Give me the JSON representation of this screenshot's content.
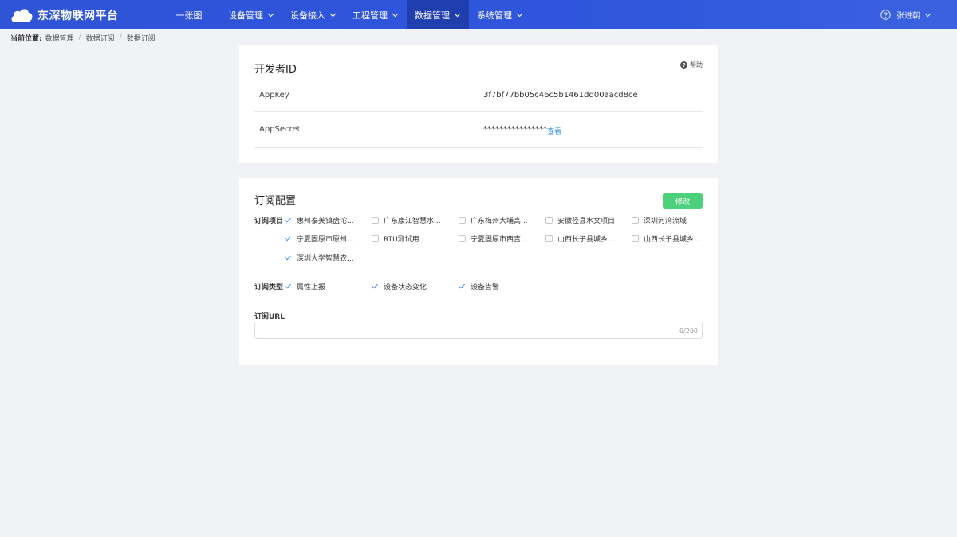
{
  "app": {
    "title": "东深物联网平台"
  },
  "nav": {
    "items": [
      {
        "label": "一张图",
        "has_dropdown": false,
        "active": false
      },
      {
        "label": "设备管理",
        "has_dropdown": true,
        "active": false
      },
      {
        "label": "设备接入",
        "has_dropdown": true,
        "active": false
      },
      {
        "label": "工程管理",
        "has_dropdown": true,
        "active": false
      },
      {
        "label": "数据管理",
        "has_dropdown": true,
        "active": true
      },
      {
        "label": "系统管理",
        "has_dropdown": true,
        "active": false
      }
    ]
  },
  "user": {
    "name": "张进朝",
    "icon": "help-circle-icon"
  },
  "breadcrumb": {
    "label": "当前位置:",
    "items": [
      "数据管理",
      "数据订阅",
      "数据订阅"
    ],
    "separator": "/"
  },
  "developer": {
    "title": "开发者ID",
    "help_label": "帮助",
    "app_key_label": "AppKey",
    "app_key_value": "3f7bf77bb05c46c5b1461dd00aacd8ce",
    "app_secret_label": "AppSecret",
    "app_secret_value": "****************",
    "view_label": "查看"
  },
  "subscription": {
    "title": "订阅配置",
    "edit_label": "修改",
    "projects_label": "订阅项目",
    "projects": [
      {
        "label": "惠州泰美镇盘沱...",
        "checked": true
      },
      {
        "label": "广东康江智慧水...",
        "checked": false
      },
      {
        "label": "广东梅州大埔高...",
        "checked": false
      },
      {
        "label": "安徽径县水文项目",
        "checked": false
      },
      {
        "label": "深圳河湾流域",
        "checked": false
      },
      {
        "label": "宁夏固原市原州...",
        "checked": true
      },
      {
        "label": "RTU测试用",
        "checked": false
      },
      {
        "label": "宁夏固原市西吉...",
        "checked": false
      },
      {
        "label": "山西长子县城乡...",
        "checked": false
      },
      {
        "label": "山西长子县城乡...",
        "checked": false
      },
      {
        "label": "深圳大学智慧农...",
        "checked": true
      }
    ],
    "types_label": "订阅类型",
    "types": [
      {
        "label": "属性上报",
        "checked": true
      },
      {
        "label": "设备状态变化",
        "checked": true
      },
      {
        "label": "设备告警",
        "checked": true
      }
    ],
    "url_label": "订阅URL",
    "url_value": "",
    "url_counter": "0/200"
  },
  "colors": {
    "topbar": "#2f54d8",
    "nav_active": "#1f3fae",
    "accent_green": "#4cd07c",
    "link_blue": "#3a8ee6",
    "background": "#f0f2f5"
  }
}
